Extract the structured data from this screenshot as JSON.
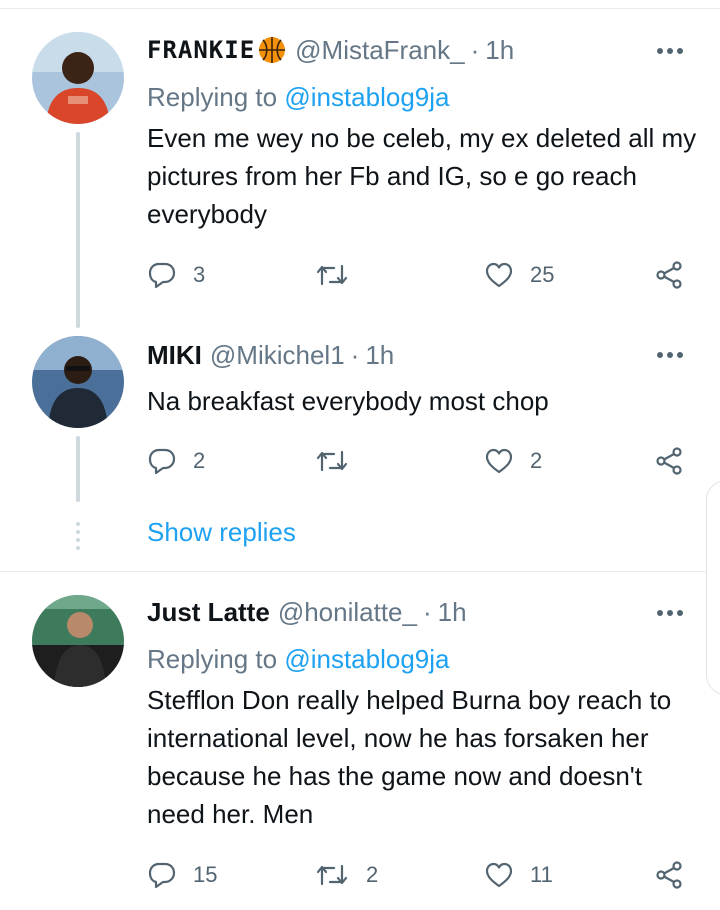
{
  "tweets": [
    {
      "name": "FRANKIE",
      "handle": "@MistaFrank_",
      "time": "1h",
      "replying_prefix": "Replying to",
      "replying_to": "@instablog9ja",
      "text": "Even me wey no be celeb, my ex deleted all my pictures from her Fb and IG, so e go reach everybody",
      "replies": "3",
      "retweets": "",
      "likes": "25",
      "avatar_colors": [
        "#8fb4d6",
        "#d9462a"
      ]
    },
    {
      "name": "MIKI",
      "handle": "@Mikichel1",
      "time": "1h",
      "text": "Na breakfast everybody most chop",
      "replies": "2",
      "retweets": "",
      "likes": "2",
      "avatar_colors": [
        "#3b5f8a",
        "#1c2b3e"
      ]
    },
    {
      "name": "Just Latte",
      "handle": "@honilatte_",
      "time": "1h",
      "replying_prefix": "Replying to",
      "replying_to": "@instablog9ja",
      "text": "Stefflon Don really helped Burna boy reach to international level, now he has forsaken her because he has the game now and doesn't need her. Men",
      "replies": "15",
      "retweets": "2",
      "likes": "11",
      "avatar_colors": [
        "#4c8a6a",
        "#2a2a2a"
      ]
    }
  ],
  "show_replies_label": "Show replies",
  "separator": "·",
  "icons": {
    "reply": "reply-icon",
    "retweet": "retweet-icon",
    "like": "heart-icon",
    "share": "share-icon",
    "more": "more-icon",
    "name_emoji": "basketball-icon"
  },
  "colors": {
    "accent": "#1da1f2",
    "muted": "#657786",
    "icon": "#536471",
    "divider": "#e6ecf0"
  }
}
